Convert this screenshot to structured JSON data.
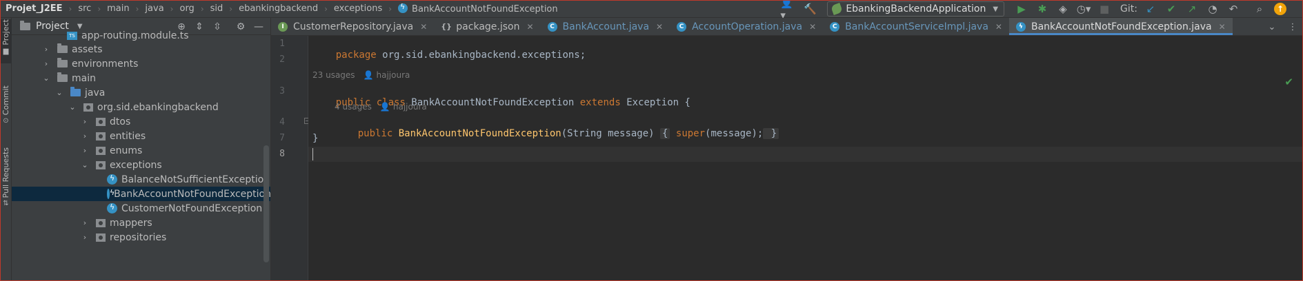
{
  "navbar": {
    "breadcrumbs": [
      "Projet_J2EE",
      "src",
      "main",
      "java",
      "org",
      "sid",
      "ebankingbackend",
      "exceptions",
      "BankAccountNotFoundException"
    ],
    "run_config": "EbankingBackendApplication",
    "git_label": "Git:",
    "icons": [
      "user-icon",
      "hammer-icon",
      "run-icon",
      "debug-icon",
      "coverage-icon",
      "profile-icon",
      "stop-icon",
      "git-update-icon",
      "git-commit-icon",
      "git-push-icon",
      "history-icon",
      "rollback-icon",
      "search-icon",
      "update-badge-icon"
    ],
    "update_badge": "↑"
  },
  "stripe": {
    "items": [
      "Project",
      "Commit",
      "Pull Requests"
    ]
  },
  "project_panel": {
    "title": "Project",
    "tree": [
      {
        "label": "app-routing.module.ts",
        "kind": "ts"
      },
      {
        "label": "assets",
        "kind": "folder",
        "expanded": false
      },
      {
        "label": "environments",
        "kind": "folder",
        "expanded": false
      },
      {
        "label": "main",
        "kind": "folder",
        "expanded": true
      },
      {
        "label": "java",
        "kind": "folder-blue",
        "expanded": true
      },
      {
        "label": "org.sid.ebankingbackend",
        "kind": "package",
        "expanded": true
      },
      {
        "label": "dtos",
        "kind": "package",
        "expanded": false
      },
      {
        "label": "entities",
        "kind": "package",
        "expanded": false
      },
      {
        "label": "enums",
        "kind": "package",
        "expanded": false
      },
      {
        "label": "exceptions",
        "kind": "package",
        "expanded": true
      },
      {
        "label": "BalanceNotSufficientException",
        "kind": "exception"
      },
      {
        "label": "BankAccountNotFoundException",
        "kind": "exception",
        "selected": true
      },
      {
        "label": "CustomerNotFoundException",
        "kind": "exception"
      },
      {
        "label": "mappers",
        "kind": "package",
        "expanded": false
      },
      {
        "label": "repositories",
        "kind": "package",
        "expanded": false
      }
    ]
  },
  "tabs": [
    {
      "label": "CustomerRepository.java",
      "icon": "interface-icon",
      "blue": false,
      "active": false
    },
    {
      "label": "package.json",
      "icon": "json-icon",
      "blue": false,
      "active": false
    },
    {
      "label": "BankAccount.java",
      "icon": "class-icon",
      "blue": true,
      "active": false
    },
    {
      "label": "AccountOperation.java",
      "icon": "class-icon",
      "blue": true,
      "active": false
    },
    {
      "label": "BankAccountServiceImpl.java",
      "icon": "class-icon",
      "blue": true,
      "active": false
    },
    {
      "label": "BankAccountNotFoundException.java",
      "icon": "exception-icon",
      "blue": false,
      "active": true
    }
  ],
  "editor": {
    "line_numbers": [
      "1",
      "2",
      "3",
      "4",
      "7",
      "8"
    ],
    "line1": {
      "kw": "package",
      "rest": " org.sid.ebankingbackend.exceptions;"
    },
    "hint1": {
      "usages": "23 usages",
      "author": "hajjoura"
    },
    "line3": {
      "kw1": "public class",
      "name": " BankAccountNotFoundException ",
      "kw2": "extends",
      "rest": " Exception {"
    },
    "hint2": {
      "usages": "4 usages",
      "author": "hajjoura"
    },
    "line4": {
      "kw": "public",
      "fn": " BankAccountNotFoundException",
      "args": "(String message) ",
      "open": "{",
      "kw_super": " super",
      "call": "(message);",
      "close": " }"
    },
    "line7": "}",
    "current_line": "8"
  }
}
